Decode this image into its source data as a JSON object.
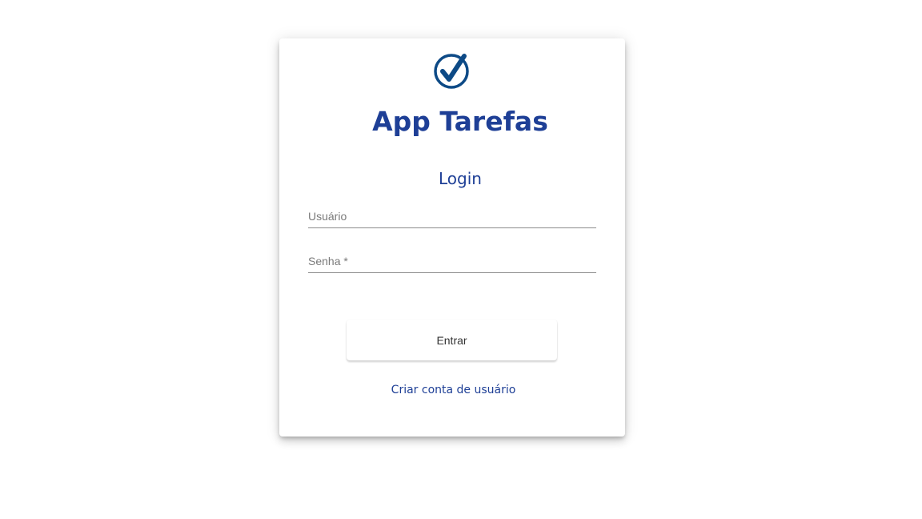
{
  "app": {
    "title": "App Tarefas",
    "logo_icon": "check-circle-icon",
    "brand_color": "#1e3f96"
  },
  "login": {
    "title": "Login",
    "username_placeholder": "Usuário",
    "username_value": "",
    "password_placeholder": "Senha *",
    "password_value": "",
    "submit_label": "Entrar",
    "create_account_label": "Criar conta de usuário"
  }
}
